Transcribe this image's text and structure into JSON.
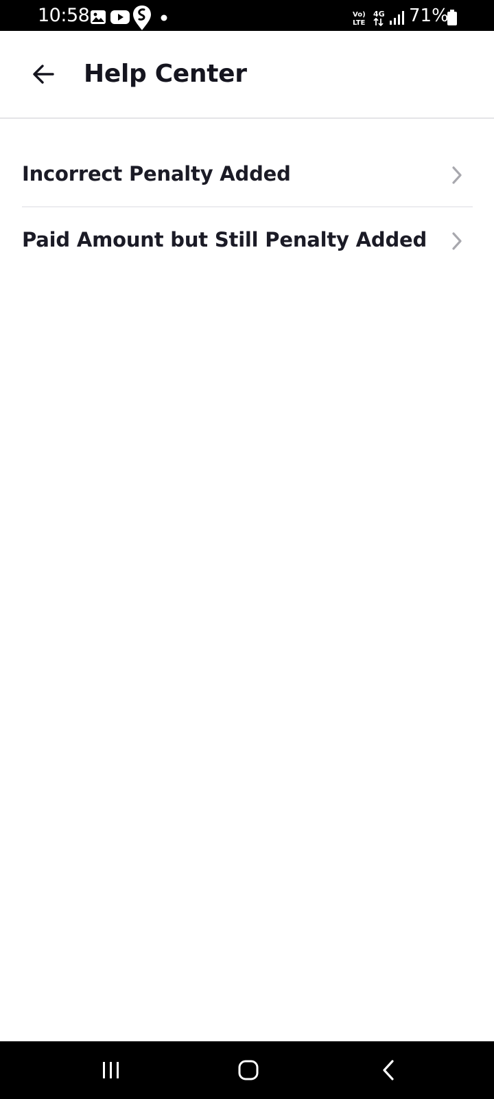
{
  "status_bar": {
    "time": "10:58",
    "battery": "71%",
    "network": "4G",
    "volte": "VoLTE",
    "icons": [
      "gallery-icon",
      "youtube-icon",
      "swiggy-icon",
      "dot-icon",
      "volte-icon",
      "network-4g-icon",
      "signal-icon",
      "battery-icon"
    ]
  },
  "app_bar": {
    "title": "Help Center",
    "back_icon": "arrow-left-icon"
  },
  "list": {
    "items": [
      {
        "label": "Incorrect Penalty Added",
        "icon": "chevron-right-icon"
      },
      {
        "label": "Paid Amount but Still Penalty Added",
        "icon": "chevron-right-icon"
      }
    ]
  },
  "nav_bar": {
    "icons": [
      "recents-icon",
      "home-icon",
      "back-icon"
    ]
  },
  "colors": {
    "text_primary": "#1b1b26",
    "divider": "#e4e4e7",
    "chevron": "#a8a8ae",
    "system_bar": "#000000"
  }
}
